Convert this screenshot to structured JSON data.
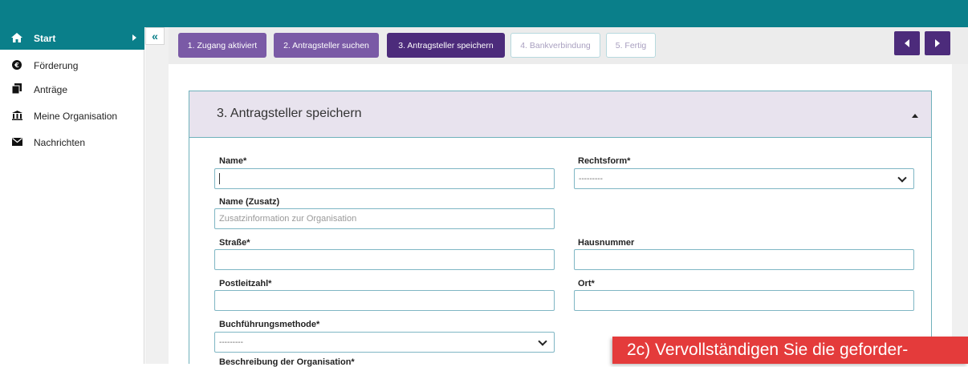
{
  "colors": {
    "topbar": "#0a7f8a",
    "step_done": "#7a5aa6",
    "step_current": "#4c2b7b",
    "callout": "#e43b3b"
  },
  "sidebar": {
    "items": [
      {
        "label": "Start",
        "icon": "home-icon",
        "active": true
      },
      {
        "label": "Förderung",
        "icon": "euro-icon"
      },
      {
        "label": "Anträge",
        "icon": "documents-icon"
      },
      {
        "label": "Meine Organisation",
        "icon": "bank-icon"
      },
      {
        "label": "Nachrichten",
        "icon": "envelope-icon"
      }
    ],
    "collapse_label": "«"
  },
  "steps": [
    {
      "label": "1. Zugang aktiviert",
      "state": "done"
    },
    {
      "label": "2. Antragsteller suchen",
      "state": "done"
    },
    {
      "label": "3. Antragsteller speichern",
      "state": "current"
    },
    {
      "label": "4. Bankverbindung",
      "state": "todo"
    },
    {
      "label": "5. Fertig",
      "state": "todo"
    }
  ],
  "nav": {
    "prev_icon": "chevron-left-icon",
    "next_icon": "chevron-right-icon"
  },
  "panel": {
    "title": "3. Antragsteller speichern"
  },
  "form": {
    "name_label": "Name*",
    "rechtsform_label": "Rechtsform*",
    "rechtsform_value": "---------",
    "name_zusatz_label": "Name (Zusatz)",
    "name_zusatz_placeholder": "Zusatzinformation zur Organisation",
    "strasse_label": "Straße*",
    "hausnummer_label": "Hausnummer",
    "plz_label": "Postleitzahl*",
    "ort_label": "Ort*",
    "buchfuehrung_label": "Buchführungsmethode*",
    "buchfuehrung_value": "---------",
    "cut_label": "Beschreibung der Organisation*"
  },
  "callout": {
    "text": "2c) Vervollständigen Sie die geforder-"
  }
}
